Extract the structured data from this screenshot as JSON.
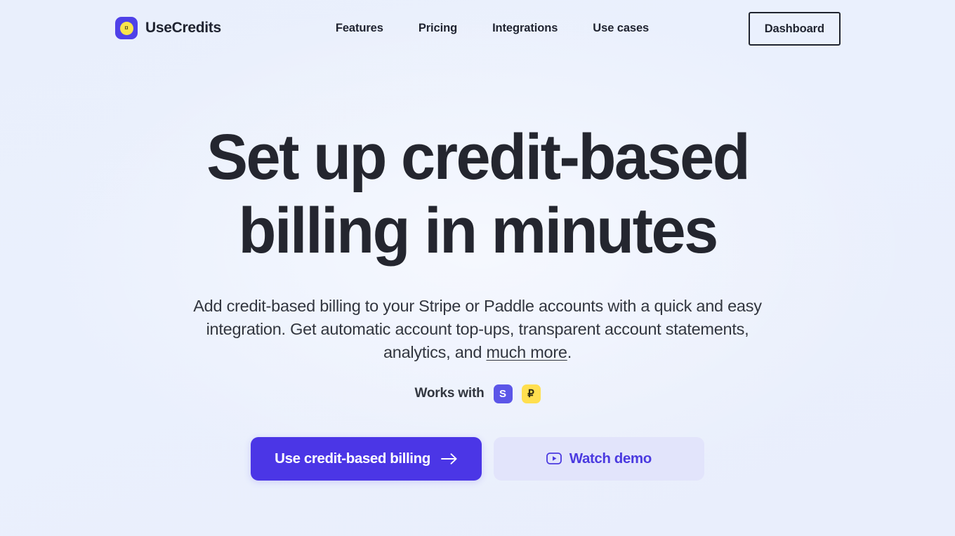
{
  "theme": {
    "background_start": "#e9effc",
    "background_end": "#e9eefc",
    "accent_indigo": "#4b36e6",
    "accent_soft": "#e2e4fb",
    "text_primary": "#24262f",
    "text_body": "#32363f",
    "stripe_badge_bg": "#5c56e8",
    "paddle_badge_bg": "#ffdf4f",
    "logo_mark_bg": "#4f41e8",
    "logo_coin_bg": "#fae54a"
  },
  "header": {
    "brand": {
      "name": "UseCredits",
      "mark_icon": "coin-icon",
      "coin_glyph": "¤"
    },
    "nav": [
      {
        "label": "Features"
      },
      {
        "label": "Pricing"
      },
      {
        "label": "Integrations"
      },
      {
        "label": "Use cases"
      }
    ],
    "dashboard_label": "Dashboard"
  },
  "hero": {
    "title_line_1": "Set up credit-based",
    "title_line_2": "billing in minutes",
    "subtitle_line_1": "Add credit-based billing to your Stripe or Paddle accounts with a quick and easy integration.",
    "subtitle_line_2_before": "Get automatic account top-ups, transparent account statements, analytics, and ",
    "subtitle_link": "much more",
    "subtitle_line_2_after": ".",
    "works_with_label": "Works with",
    "providers": [
      {
        "name": "Stripe",
        "glyph": "S",
        "icon": "stripe-icon"
      },
      {
        "name": "Paddle",
        "glyph": "₽",
        "icon": "paddle-icon"
      }
    ],
    "primary_cta": {
      "label": "Use credit-based billing",
      "icon": "arrow-right-icon"
    },
    "secondary_cta": {
      "label": "Watch demo",
      "icon": "play-icon"
    }
  }
}
